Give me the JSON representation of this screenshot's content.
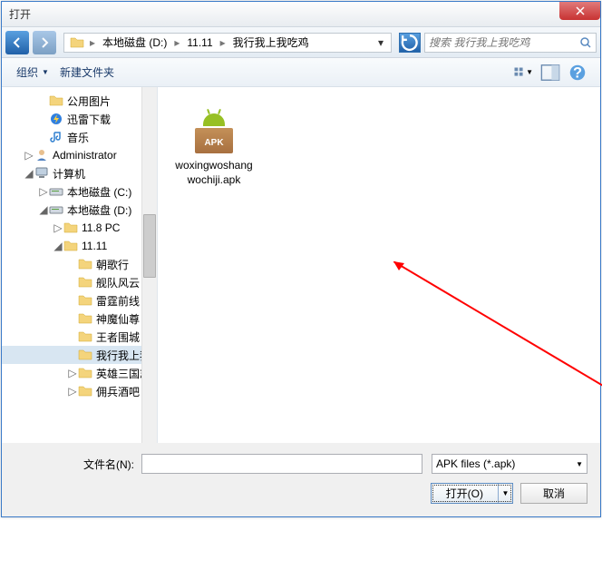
{
  "window": {
    "title": "打开"
  },
  "breadcrumb": {
    "items": [
      "本地磁盘 (D:)",
      "11.11",
      "我行我上我吃鸡"
    ]
  },
  "search": {
    "placeholder": "搜索 我行我上我吃鸡"
  },
  "toolbar": {
    "organize": "组织",
    "newfolder": "新建文件夹"
  },
  "tree": {
    "items": [
      {
        "label": "公用图片",
        "indent": 40,
        "expand": "",
        "icon": "folder"
      },
      {
        "label": "迅雷下载",
        "indent": 40,
        "expand": "",
        "icon": "thunder"
      },
      {
        "label": "音乐",
        "indent": 40,
        "expand": "",
        "icon": "music"
      },
      {
        "label": "Administrator",
        "indent": 24,
        "expand": "▷",
        "icon": "user"
      },
      {
        "label": "计算机",
        "indent": 24,
        "expand": "◢",
        "icon": "computer"
      },
      {
        "label": "本地磁盘 (C:)",
        "indent": 40,
        "expand": "▷",
        "icon": "drive"
      },
      {
        "label": "本地磁盘 (D:)",
        "indent": 40,
        "expand": "◢",
        "icon": "drive"
      },
      {
        "label": "11.8 PC",
        "indent": 56,
        "expand": "▷",
        "icon": "folder"
      },
      {
        "label": "11.11",
        "indent": 56,
        "expand": "◢",
        "icon": "folder"
      },
      {
        "label": "朝歌行",
        "indent": 72,
        "expand": "",
        "icon": "folder"
      },
      {
        "label": "舰队风云",
        "indent": 72,
        "expand": "",
        "icon": "folder"
      },
      {
        "label": "雷霆前线",
        "indent": 72,
        "expand": "",
        "icon": "folder"
      },
      {
        "label": "神魔仙尊",
        "indent": 72,
        "expand": "",
        "icon": "folder"
      },
      {
        "label": "王者围城",
        "indent": 72,
        "expand": "",
        "icon": "folder"
      },
      {
        "label": "我行我上我",
        "indent": 72,
        "expand": "",
        "icon": "folder",
        "sel": true
      },
      {
        "label": "英雄三国志",
        "indent": 72,
        "expand": "▷",
        "icon": "folder"
      },
      {
        "label": "佣兵酒吧",
        "indent": 72,
        "expand": "▷",
        "icon": "folder"
      }
    ]
  },
  "content": {
    "file": {
      "name": "woxingwoshang\nwochiji.apk",
      "label": "APK"
    }
  },
  "footer": {
    "filename_label": "文件名(N):",
    "filename_value": "",
    "filetype": "APK files (*.apk)",
    "open": "打开(O)",
    "cancel": "取消"
  }
}
